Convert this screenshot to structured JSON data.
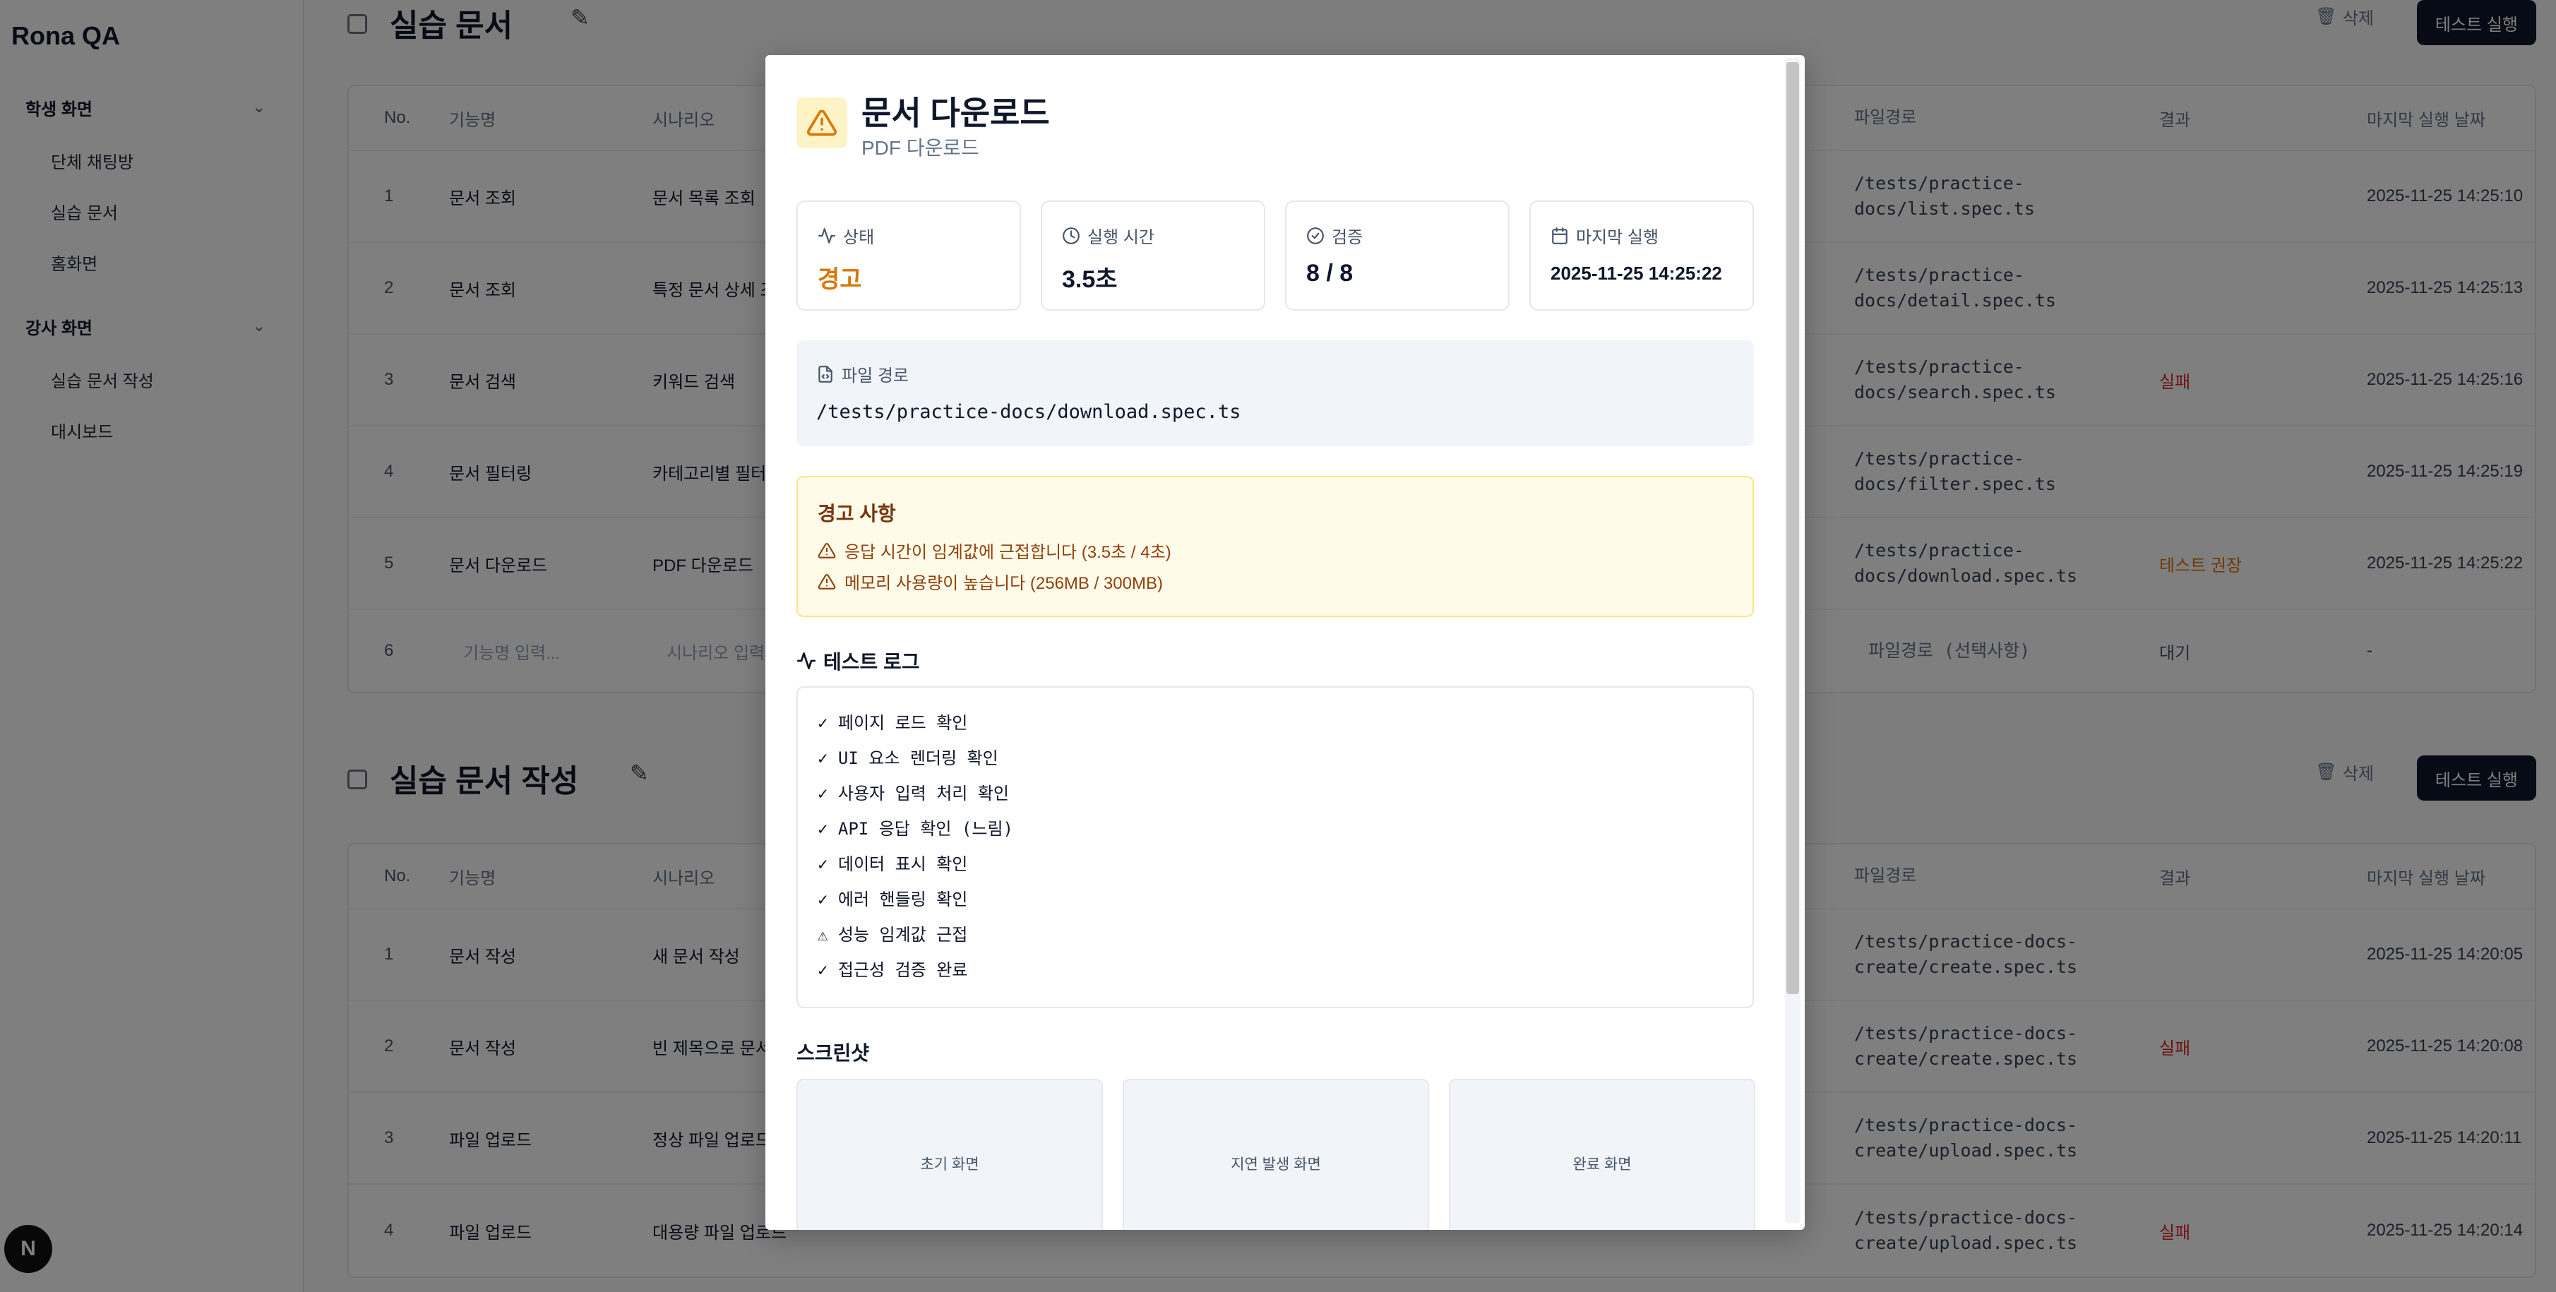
{
  "app": {
    "brand": "Rona QA",
    "badge": "N"
  },
  "sidebar": {
    "groups": [
      {
        "label": "학생 화면",
        "items": [
          "단체 채팅방",
          "실습 문서",
          "홈화면"
        ]
      },
      {
        "label": "강사 화면",
        "items": [
          "실습 문서 작성",
          "대시보드"
        ]
      }
    ]
  },
  "sections": [
    {
      "title": "실습 문서",
      "delete_label": "삭제",
      "run_label": "테스트 실행",
      "columns": [
        "No.",
        "기능명",
        "시나리오",
        "파일경로",
        "결과",
        "마지막 실행 날짜"
      ],
      "rows": [
        {
          "no": "1",
          "feature": "문서 조회",
          "scenario": "문서 목록 조회",
          "path1": "/tests/practice-",
          "path2": "docs/list.spec.ts",
          "result": "",
          "date": "2025-11-25 14:25:10"
        },
        {
          "no": "2",
          "feature": "문서 조회",
          "scenario": "특정 문서 상세 조",
          "path1": "/tests/practice-",
          "path2": "docs/detail.spec.ts",
          "result": "",
          "date": "2025-11-25 14:25:13"
        },
        {
          "no": "3",
          "feature": "문서 검색",
          "scenario": "키워드 검색",
          "path1": "/tests/practice-",
          "path2": "docs/search.spec.ts",
          "result": "실패",
          "date": "2025-11-25 14:25:16"
        },
        {
          "no": "4",
          "feature": "문서 필터링",
          "scenario": "카테고리별 필터",
          "path1": "/tests/practice-",
          "path2": "docs/filter.spec.ts",
          "result": "",
          "date": "2025-11-25 14:25:19"
        },
        {
          "no": "5",
          "feature": "문서 다운로드",
          "scenario": "PDF 다운로드",
          "path1": "/tests/practice-",
          "path2": "docs/download.spec.ts",
          "result": "테스트 권장",
          "date": "2025-11-25 14:25:22"
        }
      ],
      "new_row": {
        "no": "6",
        "feature_placeholder": "기능명 입력...",
        "scenario_placeholder": "시나리오 입력",
        "path_placeholder": "파일경로 (선택사항)",
        "result": "대기",
        "date": "-"
      }
    },
    {
      "title": "실습 문서 작성",
      "delete_label": "삭제",
      "run_label": "테스트 실행",
      "columns": [
        "No.",
        "기능명",
        "시나리오",
        "파일경로",
        "결과",
        "마지막 실행 날짜"
      ],
      "rows": [
        {
          "no": "1",
          "feature": "문서 작성",
          "scenario": "새 문서 작성",
          "path1": "/tests/practice-docs-",
          "path2": "create/create.spec.ts",
          "result": "",
          "date": "2025-11-25 14:20:05"
        },
        {
          "no": "2",
          "feature": "문서 작성",
          "scenario": "빈 제목으로 문서",
          "path1": "/tests/practice-docs-",
          "path2": "create/create.spec.ts",
          "result": "실패",
          "date": "2025-11-25 14:20:08"
        },
        {
          "no": "3",
          "feature": "파일 업로드",
          "scenario": "정상 파일 업로드",
          "path1": "/tests/practice-docs-",
          "path2": "create/upload.spec.ts",
          "result": "",
          "date": "2025-11-25 14:20:11"
        },
        {
          "no": "4",
          "feature": "파일 업로드",
          "scenario": "대용량 파일 업로드",
          "path1": "/tests/practice-docs-",
          "path2": "create/upload.spec.ts",
          "result": "실패",
          "date": "2025-11-25 14:20:14"
        }
      ]
    }
  ],
  "modal": {
    "title": "문서 다운로드",
    "subtitle": "PDF 다운로드",
    "stats": [
      {
        "label": "상태",
        "value": "경고"
      },
      {
        "label": "실행 시간",
        "value": "3.5초"
      },
      {
        "label": "검증",
        "value": "8 / 8"
      },
      {
        "label": "마지막 실행",
        "value": "2025-11-25 14:25:22"
      }
    ],
    "file_path_label": "파일 경로",
    "file_path": "/tests/practice-docs/download.spec.ts",
    "warnings_title": "경고 사항",
    "warnings": [
      "응답 시간이 임계값에 근접합니다 (3.5초 / 4초)",
      "메모리 사용량이 높습니다 (256MB / 300MB)"
    ],
    "log_title": "테스트 로그",
    "logs": [
      "✓ 페이지 로드 확인",
      "✓ UI 요소 렌더링 확인",
      "✓ 사용자 입력 처리 확인",
      "✓ API 응답 확인 (느림)",
      "✓ 데이터 표시 확인",
      "✓ 에러 핸들링 확인",
      "⚠ 성능 임계값 근접",
      "✓ 접근성 검증 완료"
    ],
    "screenshots_title": "스크린샷",
    "screenshots": [
      "초기 화면",
      "지연 발생 화면",
      "완료 화면"
    ]
  },
  "colors": {
    "warning": "#d97706",
    "fail": "#dc2626",
    "primary_button": "#0f172a"
  }
}
